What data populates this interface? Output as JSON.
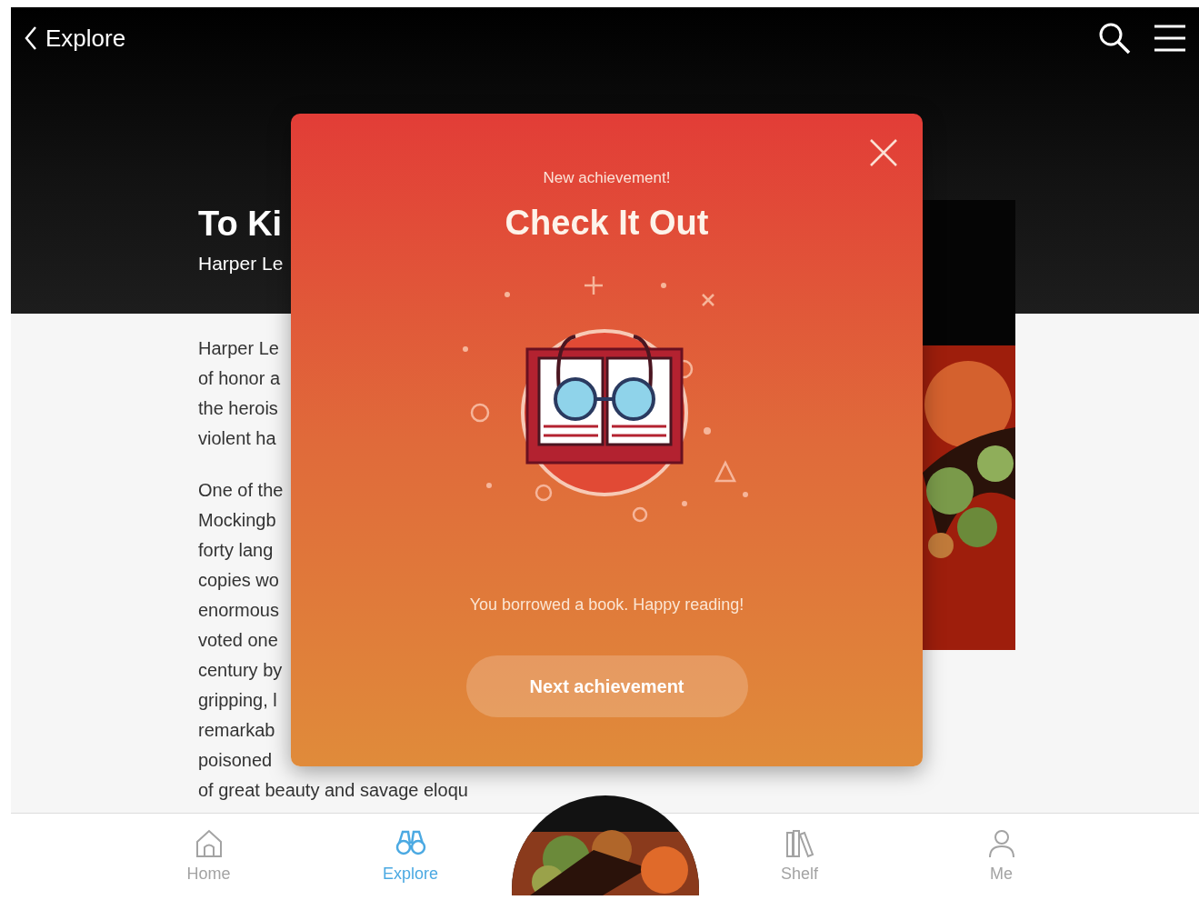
{
  "top_bar": {
    "back_label": "Explore"
  },
  "book": {
    "title": "To Ki",
    "author": "Harper Le"
  },
  "description": {
    "paragraphs": [
      [
        "Harper Le",
        "of honor a",
        "the herois",
        "violent ha"
      ],
      [
        "One of the",
        "Mockingb",
        "forty lang",
        "copies wo",
        "enormous",
        "voted one",
        "century by",
        "gripping, l",
        "remarkab",
        "poisoned",
        "of great beauty and savage eloqu"
      ]
    ]
  },
  "modal": {
    "eyebrow": "New achievement!",
    "title": "Check It Out",
    "message": "You borrowed a book. Happy reading!",
    "button": "Next achievement"
  },
  "tab_bar": [
    {
      "label": "Home",
      "selected": false
    },
    {
      "label": "Explore",
      "selected": true
    },
    {
      "label": "Shelf",
      "selected": false
    },
    {
      "label": "Me",
      "selected": false
    }
  ]
}
